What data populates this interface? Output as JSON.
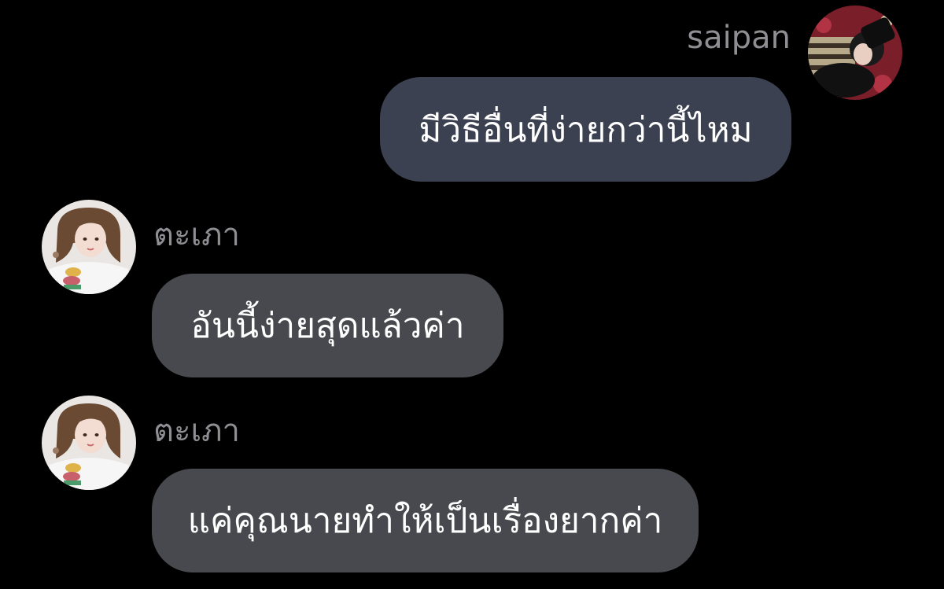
{
  "colors": {
    "background": "#000000",
    "outgoing_bubble": "#3b4150",
    "incoming_bubble": "#48494e",
    "name_text": "#8e8e93",
    "message_text": "#ffffff"
  },
  "messages": [
    {
      "direction": "outgoing",
      "sender": "saipan",
      "avatar_icon": "user-avatar-icon",
      "text": "มีวิธีอื่นที่ง่ายกว่านี้ไหม"
    },
    {
      "direction": "incoming",
      "sender": "ตะเภา",
      "avatar_icon": "user-avatar-icon",
      "text": "อันนี้ง่ายสุดแล้วค่า"
    },
    {
      "direction": "incoming",
      "sender": "ตะเภา",
      "avatar_icon": "user-avatar-icon",
      "text": "แค่คุณนายทำให้เป็นเรื่องยากค่า"
    }
  ]
}
